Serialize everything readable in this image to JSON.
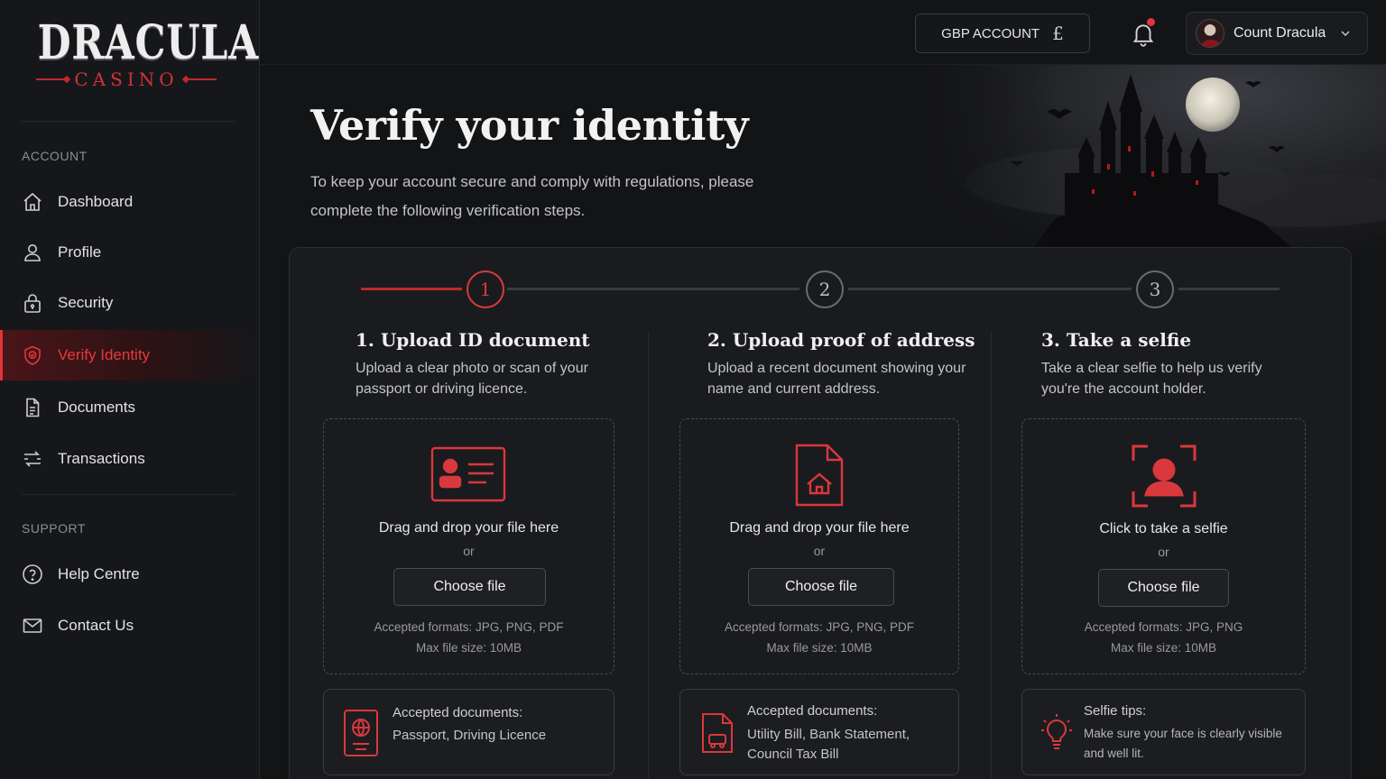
{
  "brand": {
    "name": "DRACULA",
    "tagline": "CASINO",
    "accent": "#d9383c"
  },
  "sidebar": {
    "account_label": "ACCOUNT",
    "support_label": "SUPPORT",
    "items": [
      {
        "label": "Dashboard",
        "icon": "home-icon"
      },
      {
        "label": "Profile",
        "icon": "user-icon"
      },
      {
        "label": "Security",
        "icon": "lock-icon"
      },
      {
        "label": "Verify Identity",
        "icon": "shield-icon",
        "active": true
      },
      {
        "label": "Documents",
        "icon": "document-icon"
      },
      {
        "label": "Transactions",
        "icon": "transfer-icon"
      }
    ],
    "support_items": [
      {
        "label": "Help Centre",
        "icon": "help-icon"
      },
      {
        "label": "Contact Us",
        "icon": "mail-icon"
      }
    ]
  },
  "topbar": {
    "account_label": "GBP ACCOUNT",
    "currency_symbol": "£",
    "has_notification": true,
    "user_name": "Count Dracula"
  },
  "hero": {
    "title": "Verify your identity",
    "subtitle": "To keep your account secure and comply with regulations, please complete the following verification steps."
  },
  "stepper": {
    "current": 1,
    "steps": [
      "1",
      "2",
      "3"
    ]
  },
  "steps": [
    {
      "title": "1.  Upload ID document",
      "description": "Upload a clear photo or scan of your passport or driving licence.",
      "drop_text": "Drag and drop your file here",
      "or_text": "or",
      "button_label": "Choose file",
      "formats": "Accepted formats: JPG, PNG, PDF",
      "max_size": "Max file size: 10MB",
      "info_title": "Accepted documents:",
      "info_body": "Passport, Driving Licence"
    },
    {
      "title": "2.  Upload proof of address",
      "description": "Upload a recent document showing your name and current address.",
      "drop_text": "Drag and drop your file here",
      "or_text": "or",
      "button_label": "Choose file",
      "formats": "Accepted formats: JPG, PNG, PDF",
      "max_size": "Max file size: 10MB",
      "info_title": "Accepted documents:",
      "info_body": "Utility Bill, Bank Statement, Council Tax Bill"
    },
    {
      "title": "3.  Take a selfie",
      "description": "Take a clear selfie to help us verify you're the account holder.",
      "drop_text": "Click to take a selfie",
      "or_text": "or",
      "button_label": "Choose file",
      "formats": "Accepted formats: JPG, PNG",
      "max_size": "Max file size: 10MB",
      "info_title": "Selfie tips:",
      "info_body": "Make sure your face is clearly visible and well lit."
    }
  ]
}
